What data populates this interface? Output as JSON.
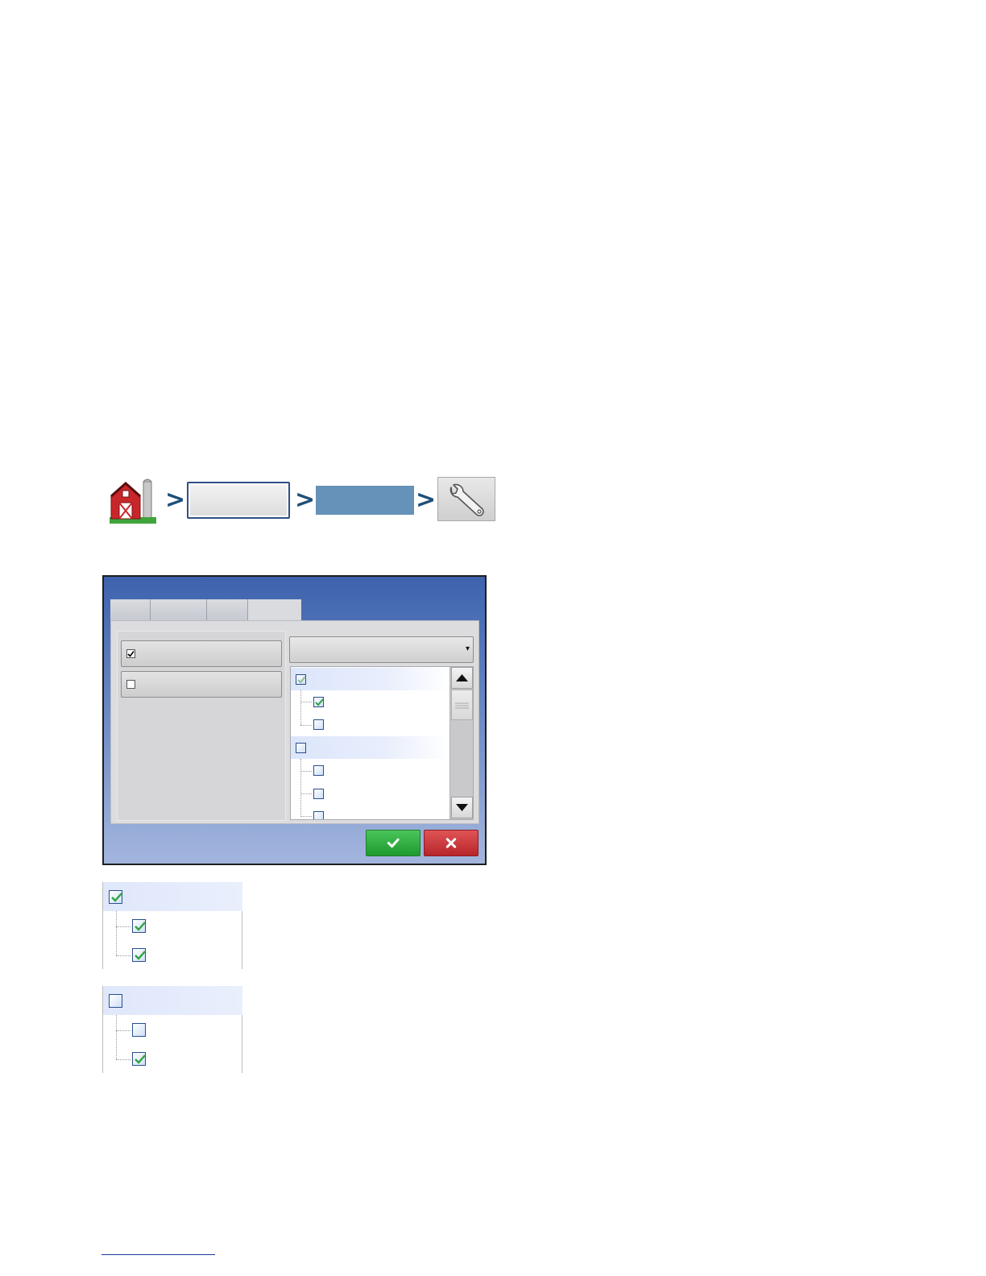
{
  "page": {
    "background": "#ffffff"
  },
  "nav_path": {
    "separator": ">",
    "steps": [
      {
        "icon": "barn-icon"
      },
      {
        "icon": "button"
      },
      {
        "icon": "button"
      },
      {
        "icon": "wrench-icon"
      }
    ]
  },
  "dialog": {
    "tabs_count": 4,
    "active_tab": 4,
    "options": [
      {
        "checked": true
      },
      {
        "checked": false
      }
    ],
    "dropdown": {
      "icon": "dropdown-arrow-icon",
      "arrow": "▾"
    },
    "tree": {
      "groups": [
        {
          "checked": true,
          "partial": true,
          "children": [
            {
              "checked": true
            },
            {
              "checked": false
            }
          ]
        },
        {
          "checked": false,
          "children": [
            {
              "checked": false
            },
            {
              "checked": false
            },
            {
              "checked": false
            }
          ]
        }
      ]
    },
    "buttons": [
      {
        "icon": "check-icon",
        "color": "#2fae40"
      },
      {
        "icon": "close-icon",
        "color": "#c9353a"
      }
    ]
  },
  "examples": [
    {
      "group_checked": true,
      "children": [
        {
          "checked": true
        },
        {
          "checked": true
        }
      ]
    },
    {
      "group_checked": false,
      "children": [
        {
          "checked": false
        },
        {
          "checked": true
        }
      ]
    }
  ],
  "colors": {
    "dialog_blue": "#3e62ad",
    "check_green": "#2ea43f",
    "nav_chevron": "#1d4f78",
    "highlight_button": "#6691b9"
  }
}
